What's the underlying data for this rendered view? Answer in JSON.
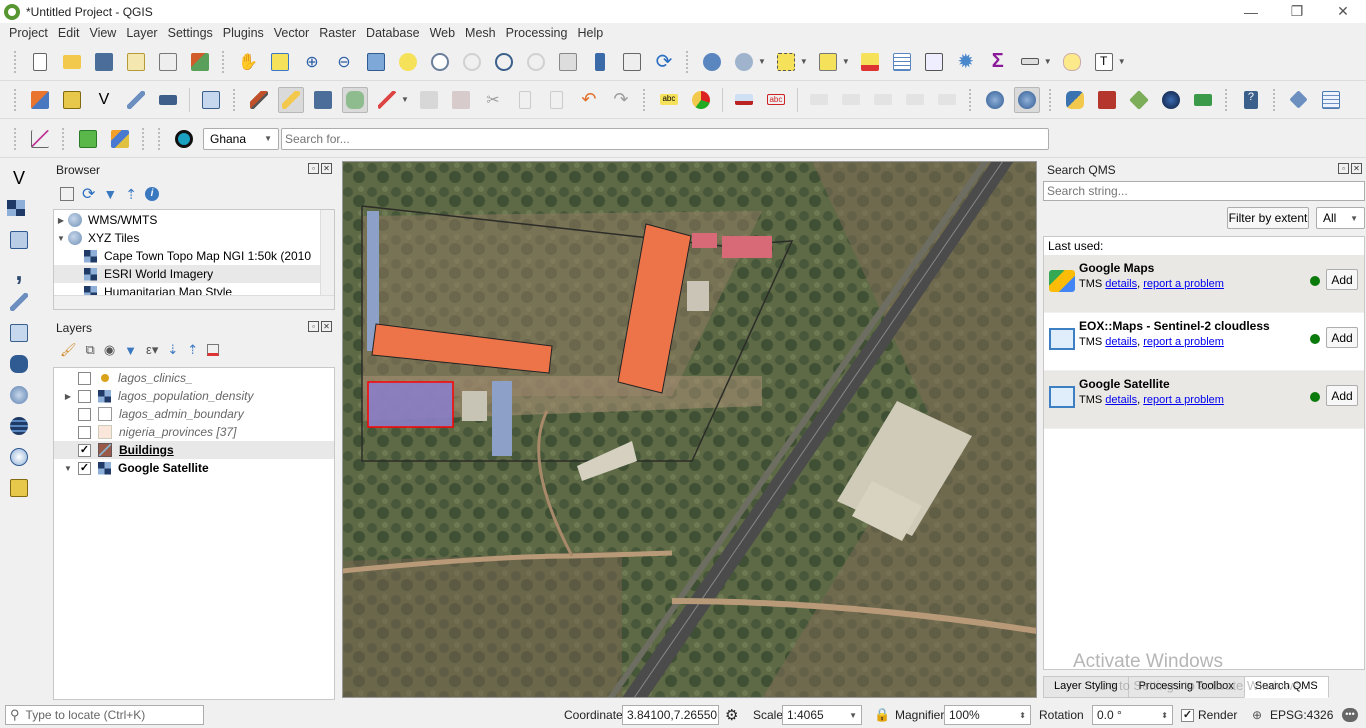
{
  "window": {
    "title": "*Untitled Project - QGIS",
    "minimize": "—",
    "restore": "❐",
    "close": "✕"
  },
  "menu": [
    "Project",
    "Edit",
    "View",
    "Layer",
    "Settings",
    "Plugins",
    "Vector",
    "Raster",
    "Database",
    "Web",
    "Mesh",
    "Processing",
    "Help"
  ],
  "locator_bar": {
    "country": "Ghana",
    "search_placeholder": "Search for..."
  },
  "browser": {
    "title": "Browser",
    "items": [
      {
        "label": "WMS/WMTS",
        "icon": "globe-icon",
        "expanded": false,
        "level": 0
      },
      {
        "label": "XYZ Tiles",
        "icon": "globe-icon",
        "expanded": true,
        "level": 0
      },
      {
        "label": "Cape Town Topo Map NGI 1:50k (2010",
        "icon": "tile-layer-icon",
        "level": 1
      },
      {
        "label": "ESRI World Imagery",
        "icon": "tile-layer-icon",
        "level": 1,
        "selected": true
      },
      {
        "label": "Humanitarian Map Style",
        "icon": "tile-layer-icon",
        "level": 1
      }
    ]
  },
  "layers": {
    "title": "Layers",
    "items": [
      {
        "label": "lagos_clinics_",
        "checked": false,
        "icon": "point-symbol-icon",
        "style": "italic"
      },
      {
        "label": "lagos_population_density",
        "checked": false,
        "icon": "raster-icon",
        "style": "italic",
        "expander": "collapsed"
      },
      {
        "label": "lagos_admin_boundary",
        "checked": false,
        "icon": "polygon-empty-icon",
        "style": "italic"
      },
      {
        "label": "nigeria_provinces [37]",
        "checked": false,
        "icon": "polygon-peach-icon",
        "style": "italic"
      },
      {
        "label": "Buildings",
        "checked": true,
        "icon": "polygon-edit-icon",
        "style": "bold-underline",
        "selected": true
      },
      {
        "label": "Google Satellite",
        "checked": true,
        "icon": "raster-icon",
        "style": "bold",
        "expander": "expanded"
      }
    ]
  },
  "qms": {
    "title": "Search QMS",
    "search_placeholder": "Search string...",
    "filter_button": "Filter by extent",
    "filter_value": "All",
    "last_used_label": "Last used:",
    "results": [
      {
        "name": "Google Maps",
        "type": "TMS",
        "details": "details",
        "report": "report a problem",
        "status_color": "#0a7a0a",
        "add": "Add",
        "icon": "google-maps-icon"
      },
      {
        "name": "EOX::Maps - Sentinel-2 cloudless",
        "type": "TMS",
        "details": "details",
        "report": "report a problem",
        "status_color": "#0a7a0a",
        "add": "Add",
        "icon": "map-icon"
      },
      {
        "name": "Google Satellite",
        "type": "TMS",
        "details": "details",
        "report": "report a problem",
        "status_color": "#0a7a0a",
        "add": "Add",
        "icon": "map-icon"
      }
    ]
  },
  "dock_tabs": [
    {
      "label": "Layer Styling",
      "active": false
    },
    {
      "label": "Processing Toolbox",
      "active": false
    },
    {
      "label": "Search QMS",
      "active": true
    }
  ],
  "watermark": {
    "line1": "Activate Windows",
    "line2": "Go to Settings to activate Windows."
  },
  "status": {
    "locate_placeholder": "Type to locate (Ctrl+K)",
    "coordinate_label": "Coordinate",
    "coordinate_value": "3.84100,7.26550",
    "scale_label": "Scale",
    "scale_value": "1:4065",
    "magnifier_label": "Magnifier",
    "magnifier_value": "100%",
    "rotation_label": "Rotation",
    "rotation_value": "0.0 °",
    "render_label": "Render",
    "render_checked": true,
    "crs": "EPSG:4326"
  },
  "colors": {
    "building_fill": "#ec7448",
    "selected_outline": "#ff0000",
    "status_ok": "#0a7a0a"
  }
}
